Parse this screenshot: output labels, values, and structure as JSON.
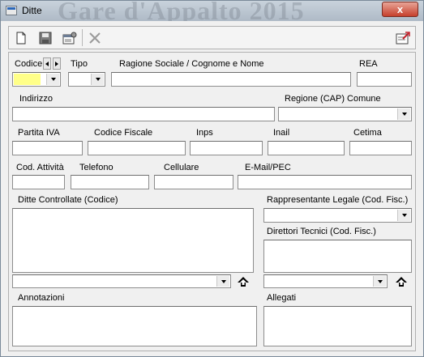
{
  "window": {
    "title": "Ditte",
    "title_watermark": "Gare d'Appalto 2015",
    "close_symbol": "x"
  },
  "toolbar": {
    "buttons": [
      {
        "name": "new-document-icon"
      },
      {
        "name": "save-icon"
      },
      {
        "name": "properties-icon"
      },
      {
        "name": "delete-icon"
      },
      {
        "name": "export-icon"
      }
    ]
  },
  "form": {
    "codice": {
      "label": "Codice",
      "value": ""
    },
    "tipo": {
      "label": "Tipo",
      "value": ""
    },
    "ragione_sociale": {
      "label": "Ragione Sociale / Cognome e Nome",
      "value": ""
    },
    "rea": {
      "label": "REA",
      "value": ""
    },
    "indirizzo": {
      "label": "Indirizzo",
      "value": ""
    },
    "regione": {
      "label": "Regione (CAP) Comune",
      "value": ""
    },
    "partita_iva": {
      "label": "Partita IVA",
      "value": ""
    },
    "codice_fiscale": {
      "label": "Codice Fiscale",
      "value": ""
    },
    "inps": {
      "label": "Inps",
      "value": ""
    },
    "inail": {
      "label": "Inail",
      "value": ""
    },
    "cetima": {
      "label": "Cetima",
      "value": ""
    },
    "cod_attivita": {
      "label": "Cod. Attività",
      "value": ""
    },
    "telefono": {
      "label": "Telefono",
      "value": ""
    },
    "cellulare": {
      "label": "Cellulare",
      "value": ""
    },
    "email": {
      "label": "E-Mail/PEC",
      "value": ""
    },
    "ditte_controllate": {
      "label": "Ditte Controllate (Codice)",
      "value": ""
    },
    "rappresentante": {
      "label": "Rappresentante Legale (Cod. Fisc.)",
      "value": ""
    },
    "direttori": {
      "label": "Direttori Tecnici (Cod. Fisc.)",
      "value": ""
    },
    "annotazioni": {
      "label": "Annotazioni",
      "value": ""
    },
    "allegati": {
      "label": "Allegati",
      "value": ""
    }
  },
  "colors": {
    "codice_highlight": "#ffff88",
    "close_button": "#c6402c",
    "window_bg": "#f0f0f0"
  }
}
